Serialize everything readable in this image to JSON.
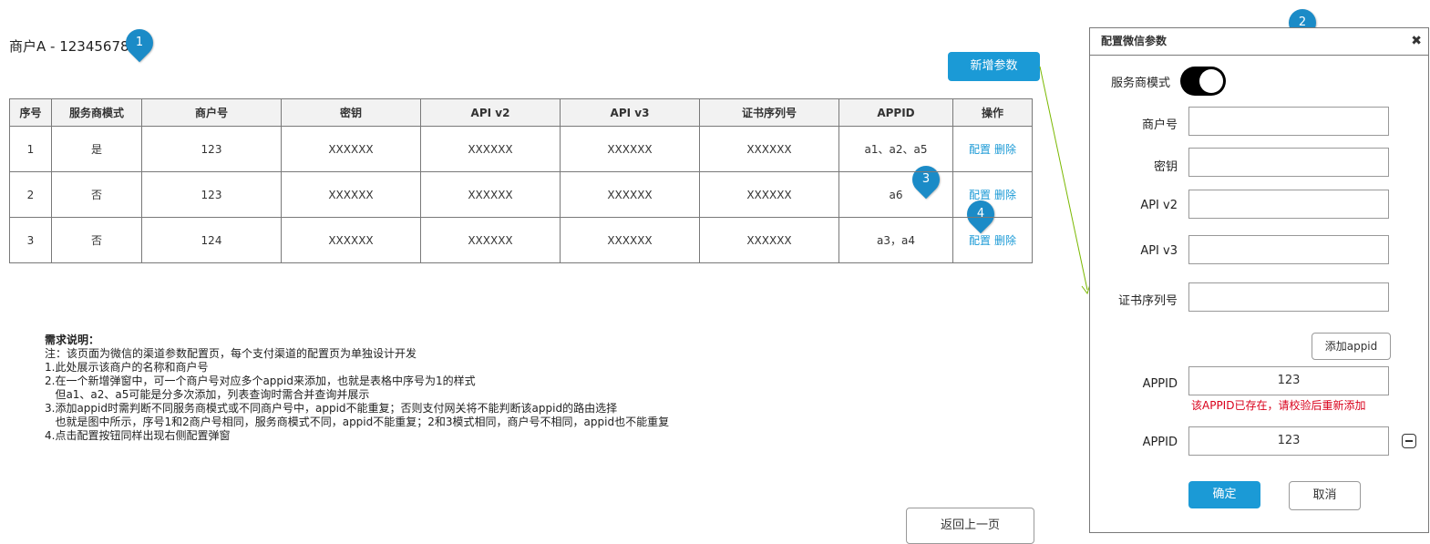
{
  "page": {
    "merchant_title": "商户A - 12345678",
    "add_button": "新增参数",
    "back_button": "返回上一页"
  },
  "pins": [
    "1",
    "2",
    "3",
    "4"
  ],
  "table": {
    "headers": [
      "序号",
      "服务商模式",
      "商户号",
      "密钥",
      "API v2",
      "API v3",
      "证书序列号",
      "APPID",
      "操作"
    ],
    "rows": [
      {
        "no": "1",
        "mode": "是",
        "merchant_no": "123",
        "secret": "XXXXXX",
        "api_v2": "XXXXXX",
        "api_v3": "XXXXXX",
        "cert_serial": "XXXXXX",
        "appid": "a1、a2、a5",
        "config": "配置",
        "delete": "删除"
      },
      {
        "no": "2",
        "mode": "否",
        "merchant_no": "123",
        "secret": "XXXXXX",
        "api_v2": "XXXXXX",
        "api_v3": "XXXXXX",
        "cert_serial": "XXXXXX",
        "appid": "a6",
        "config": "配置",
        "delete": "删除"
      },
      {
        "no": "3",
        "mode": "否",
        "merchant_no": "124",
        "secret": "XXXXXX",
        "api_v2": "XXXXXX",
        "api_v3": "XXXXXX",
        "cert_serial": "XXXXXX",
        "appid": "a3，a4",
        "config": "配置",
        "delete": "删除"
      }
    ]
  },
  "notes": {
    "title": "需求说明：",
    "lines": [
      "注：该页面为微信的渠道参数配置页，每个支付渠道的配置页为单独设计开发",
      "1.此处展示该商户的名称和商户号",
      "",
      "2.在一个新增弹窗中，可一个商户号对应多个appid来添加，也就是表格中序号为1的样式",
      "   但a1、a2、a5可能是分多次添加，列表查询时需合并查询并展示",
      "",
      "3.添加appid时需判断不同服务商模式或不同商户号中，appid不能重复；否则支付网关将不能判断该appid的路由选择",
      "   也就是图中所示，序号1和2商户号相同，服务商模式不同，appid不能重复；2和3模式相同，商户号不相同，appid也不能重复",
      "",
      "4.点击配置按钮同样出现右侧配置弹窗"
    ]
  },
  "dialog": {
    "title": "配置微信参数",
    "close": "✖",
    "provider_mode_label": "服务商模式",
    "provider_mode_on": true,
    "merchant_no_label": "商户号",
    "secret_label": "密钥",
    "api_v2_label": "API v2",
    "api_v3_label": "API v3",
    "cert_serial_label": "证书序列号",
    "add_appid_button": "添加appid",
    "appid_label_1": "APPID",
    "appid_value_1": "123",
    "appid_error": "该APPID已存在，请校验后重新添加",
    "appid_label_2": "APPID",
    "appid_value_2": "123",
    "ok_button": "确定",
    "cancel_button": "取消"
  },
  "colors": {
    "accent": "#1b9ad6",
    "pin": "#1b8bc7",
    "error": "#d9001b",
    "arrow": "#7ab800"
  }
}
